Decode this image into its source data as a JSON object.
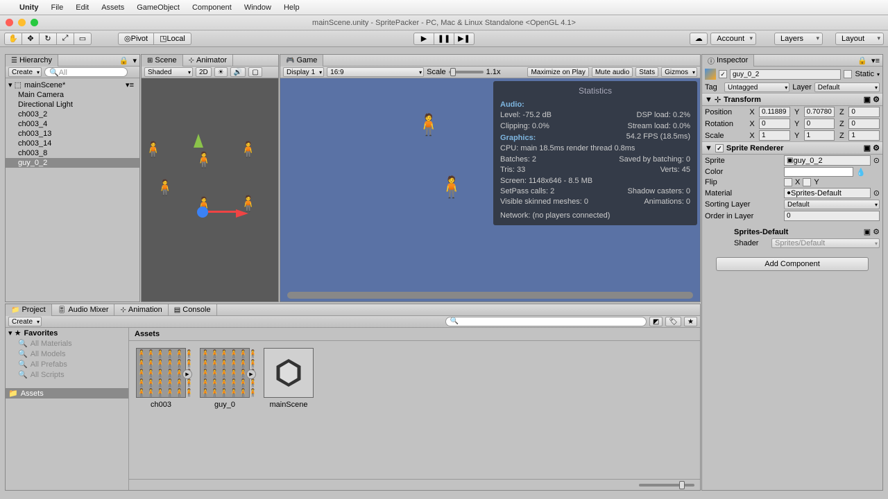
{
  "menubar": {
    "app": "Unity",
    "items": [
      "File",
      "Edit",
      "Assets",
      "GameObject",
      "Component",
      "Window",
      "Help"
    ]
  },
  "window_title": "mainScene.unity - SpritePacker - PC, Mac & Linux Standalone <OpenGL 4.1>",
  "toolbar": {
    "pivot": "Pivot",
    "local": "Local",
    "account": "Account",
    "layers": "Layers",
    "layout": "Layout"
  },
  "hierarchy": {
    "tab": "Hierarchy",
    "create": "Create",
    "search_placeholder": "All",
    "scene": "mainScene*",
    "items": [
      "Main Camera",
      "Directional Light",
      "ch003_2",
      "ch003_4",
      "ch003_13",
      "ch003_14",
      "ch003_8",
      "guy_0_2"
    ]
  },
  "scene_panel": {
    "tab_scene": "Scene",
    "tab_animator": "Animator",
    "shading": "Shaded",
    "mode2d": "2D"
  },
  "game_panel": {
    "tab": "Game",
    "display": "Display 1",
    "aspect": "16:9",
    "scale_label": "Scale",
    "scale_value": "1.1x",
    "maximize": "Maximize on Play",
    "mute": "Mute audio",
    "stats": "Stats",
    "gizmos": "Gizmos"
  },
  "statistics": {
    "title": "Statistics",
    "audio_header": "Audio:",
    "audio": {
      "level": "Level: -75.2 dB",
      "dsp": "DSP load: 0.2%",
      "clipping": "Clipping: 0.0%",
      "stream": "Stream load: 0.0%"
    },
    "graphics_header": "Graphics:",
    "fps": "54.2 FPS (18.5ms)",
    "cpu": "CPU: main 18.5ms  render thread 0.8ms",
    "batches": "Batches: 2",
    "saved": "Saved by batching: 0",
    "tris": "Tris: 33",
    "verts": "Verts: 45",
    "screen": "Screen: 1148x646 - 8.5 MB",
    "setpass": "SetPass calls: 2",
    "shadow": "Shadow casters: 0",
    "skinned": "Visible skinned meshes: 0",
    "anim": "Animations: 0",
    "network": "Network: (no players connected)"
  },
  "inspector": {
    "tab": "Inspector",
    "object_name": "guy_0_2",
    "static": "Static",
    "tag_label": "Tag",
    "tag_value": "Untagged",
    "layer_label": "Layer",
    "layer_value": "Default",
    "transform": {
      "title": "Transform",
      "position": {
        "label": "Position",
        "x": "0.11889",
        "y": "0.70780",
        "z": "0"
      },
      "rotation": {
        "label": "Rotation",
        "x": "0",
        "y": "0",
        "z": "0"
      },
      "scale": {
        "label": "Scale",
        "x": "1",
        "y": "1",
        "z": "1"
      }
    },
    "sprite_renderer": {
      "title": "Sprite Renderer",
      "sprite_label": "Sprite",
      "sprite_value": "guy_0_2",
      "color_label": "Color",
      "flip_label": "Flip",
      "flip_x": "X",
      "flip_y": "Y",
      "material_label": "Material",
      "material_value": "Sprites-Default",
      "sorting_label": "Sorting Layer",
      "sorting_value": "Default",
      "order_label": "Order in Layer",
      "order_value": "0"
    },
    "material": {
      "title": "Sprites-Default",
      "shader_label": "Shader",
      "shader_value": "Sprites/Default"
    },
    "add_component": "Add Component"
  },
  "project": {
    "tabs": {
      "project": "Project",
      "audio_mixer": "Audio Mixer",
      "animation": "Animation",
      "console": "Console"
    },
    "create": "Create",
    "favorites": "Favorites",
    "fav_items": [
      "All Materials",
      "All Models",
      "All Prefabs",
      "All Scripts"
    ],
    "assets_label": "Assets",
    "assets_header": "Assets",
    "assets": [
      "ch003",
      "guy_0",
      "mainScene"
    ]
  }
}
